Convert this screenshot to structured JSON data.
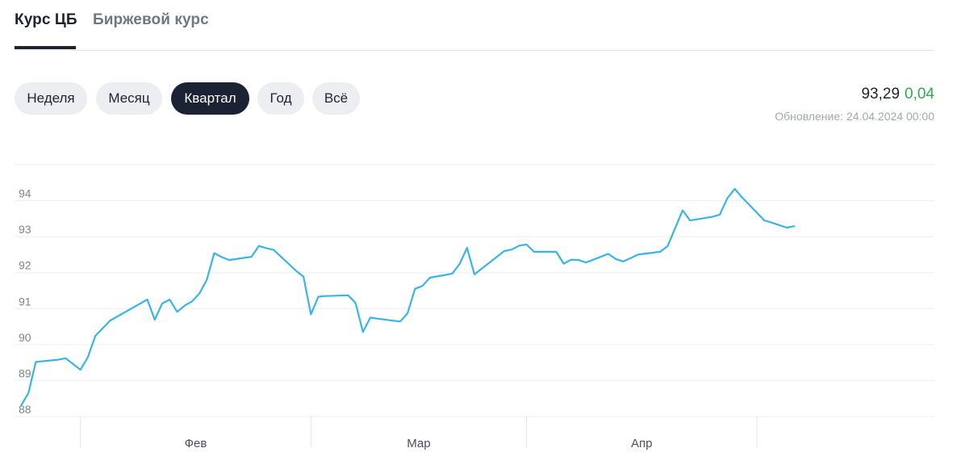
{
  "tabs": [
    {
      "label": "Курс ЦБ",
      "active": true
    },
    {
      "label": "Биржевой курс",
      "active": false
    }
  ],
  "periods": [
    {
      "label": "Неделя",
      "active": false
    },
    {
      "label": "Месяц",
      "active": false
    },
    {
      "label": "Квартал",
      "active": true
    },
    {
      "label": "Год",
      "active": false
    },
    {
      "label": "Всё",
      "active": false
    }
  ],
  "rate": {
    "value": "93,29",
    "change": "0,04",
    "change_color": "#2fa84f"
  },
  "update": {
    "label": "Обновление:",
    "datetime": "24.04.2024 00:00"
  },
  "chart_data": {
    "type": "line",
    "line_color": "#3ab4e6",
    "grid": true,
    "ylim": [
      88,
      95
    ],
    "y_ticks": [
      88,
      89,
      90,
      91,
      92,
      93,
      94
    ],
    "y_tick_labels": [
      "88",
      "89",
      "90",
      "91",
      "92",
      "93",
      "94"
    ],
    "x_tick_labels": [
      "Фев",
      "Мар",
      "Апр"
    ],
    "x_separators": [
      "2024-01-01",
      "2024-02-01",
      "2024-03-01",
      "2024-04-01"
    ],
    "x_range": [
      "2023-12-24",
      "2024-04-24"
    ],
    "x": [
      "2023-12-24",
      "2023-12-25",
      "2023-12-26",
      "2023-12-29",
      "2023-12-30",
      "2024-01-01",
      "2024-01-02",
      "2024-01-03",
      "2024-01-05",
      "2024-01-10",
      "2024-01-11",
      "2024-01-12",
      "2024-01-13",
      "2024-01-14",
      "2024-01-15",
      "2024-01-16",
      "2024-01-17",
      "2024-01-18",
      "2024-01-19",
      "2024-01-20",
      "2024-01-21",
      "2024-01-24",
      "2024-01-25",
      "2024-01-26",
      "2024-01-27",
      "2024-01-30",
      "2024-01-31",
      "2024-02-01",
      "2024-02-02",
      "2024-02-03",
      "2024-02-06",
      "2024-02-07",
      "2024-02-08",
      "2024-02-09",
      "2024-02-10",
      "2024-02-13",
      "2024-02-14",
      "2024-02-15",
      "2024-02-16",
      "2024-02-17",
      "2024-02-20",
      "2024-02-21",
      "2024-02-22",
      "2024-02-23",
      "2024-02-27",
      "2024-02-28",
      "2024-02-29",
      "2024-03-01",
      "2024-03-02",
      "2024-03-05",
      "2024-03-06",
      "2024-03-07",
      "2024-03-08",
      "2024-03-09",
      "2024-03-12",
      "2024-03-13",
      "2024-03-14",
      "2024-03-15",
      "2024-03-16",
      "2024-03-19",
      "2024-03-20",
      "2024-03-21",
      "2024-03-22",
      "2024-03-23",
      "2024-03-26",
      "2024-03-27",
      "2024-03-28",
      "2024-03-29",
      "2024-03-30",
      "2024-04-02",
      "2024-04-03",
      "2024-04-04",
      "2024-04-05",
      "2024-04-06",
      "2024-04-09",
      "2024-04-10",
      "2024-04-11",
      "2024-04-12",
      "2024-04-13",
      "2024-04-16",
      "2024-04-17",
      "2024-04-18",
      "2024-04-19",
      "2024-04-20",
      "2024-04-23",
      "2024-04-24"
    ],
    "y": [
      88.3,
      88.65,
      89.52,
      89.58,
      89.62,
      89.3,
      89.65,
      90.24,
      90.67,
      91.25,
      90.69,
      91.14,
      91.25,
      90.91,
      91.08,
      91.2,
      91.42,
      91.8,
      92.54,
      92.43,
      92.35,
      92.44,
      92.74,
      92.68,
      92.63,
      92.05,
      91.89,
      90.84,
      91.33,
      91.35,
      91.37,
      91.16,
      90.35,
      90.75,
      90.72,
      90.64,
      90.87,
      91.55,
      91.63,
      91.86,
      91.97,
      92.24,
      92.69,
      91.95,
      92.6,
      92.64,
      92.75,
      92.78,
      92.58,
      92.58,
      92.25,
      92.36,
      92.35,
      92.28,
      92.52,
      92.38,
      92.31,
      92.4,
      92.5,
      92.58,
      92.74,
      93.24,
      93.73,
      93.45,
      93.55,
      93.61,
      94.06,
      94.33,
      94.09,
      93.45,
      93.39,
      93.32,
      93.25,
      93.29
    ]
  }
}
